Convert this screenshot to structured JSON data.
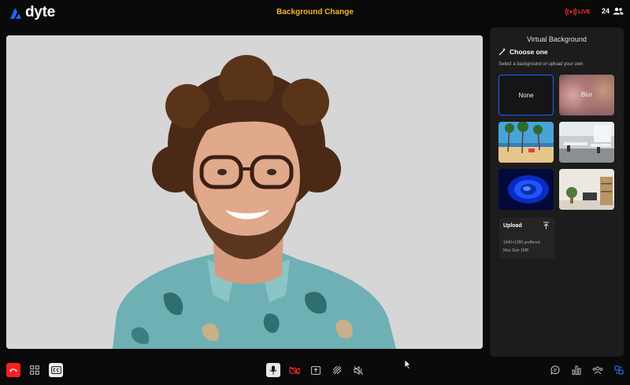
{
  "header": {
    "logo_text": "dyte",
    "meeting_title": "Background Change",
    "live_label": "LIVE",
    "participant_count": "24"
  },
  "panel": {
    "title": "Virtual Background",
    "choose_title": "Choose one",
    "choose_subtitle": "Select a background or upload your own",
    "options": [
      {
        "label": "None",
        "selected": true
      },
      {
        "label": "Blur",
        "selected": false
      },
      {
        "label": "",
        "scene": "beach palm trees"
      },
      {
        "label": "",
        "scene": "office"
      },
      {
        "label": "",
        "scene": "blue swirl"
      },
      {
        "label": "",
        "scene": "living room"
      }
    ],
    "upload": {
      "title": "Upload",
      "resolution_hint": "1440×1280 preffered",
      "size_hint": "Max Size 1MB"
    }
  },
  "controls": {
    "left": [
      "leave-call-icon",
      "grid-layout-icon",
      "captions-icon"
    ],
    "center": [
      "microphone-icon",
      "camera-off-icon",
      "screen-share-icon",
      "background-icon",
      "speaker-off-icon"
    ],
    "right": [
      "chat-icon",
      "polls-icon",
      "participants-icon",
      "plugins-icon"
    ]
  },
  "colors": {
    "accent": "#2160fd",
    "title": "#f2b52a",
    "live": "#ff2d2d",
    "danger": "#ff1f1f",
    "panel_bg": "#1c1c1c"
  }
}
